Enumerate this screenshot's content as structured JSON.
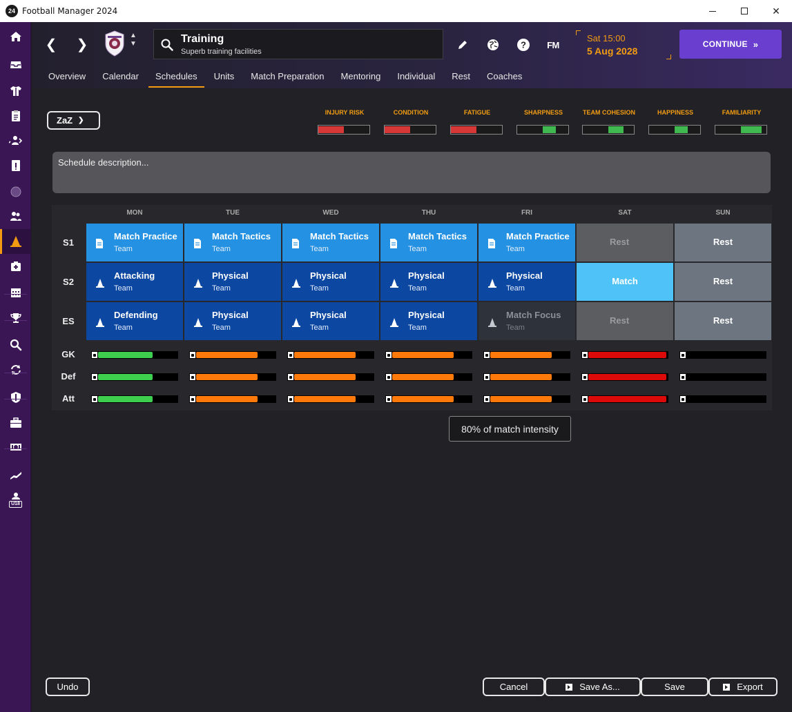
{
  "window": {
    "title": "Football Manager 2024",
    "badge": "24"
  },
  "header": {
    "search_title": "Training",
    "search_subtitle": "Superb training facilities",
    "date_line1": "Sat 15:00",
    "date_line2": "5 Aug 2028",
    "fm_label": "FM",
    "continue_label": "CONTINUE",
    "continue_chevron": "»"
  },
  "tabs": [
    "Overview",
    "Calendar",
    "Schedules",
    "Units",
    "Match Preparation",
    "Mentoring",
    "Individual",
    "Rest",
    "Coaches"
  ],
  "active_tab": "Schedules",
  "sidebar": {
    "active_index": 8,
    "icons": [
      "home-icon",
      "inbox-icon",
      "kit-icon",
      "clipboard-icon",
      "transfer-icon",
      "info-board-icon",
      "ball-icon",
      "people-icon",
      "cone-icon",
      "medical-icon",
      "calendar-icon",
      "trophy-icon",
      "scout-search-icon",
      "refresh-icon",
      "shield-icon",
      "briefcase-icon",
      "finance-icon",
      "chart-icon",
      "youth-icon"
    ],
    "youth_label": "U18"
  },
  "schedule": {
    "selector_value": "ZaZ",
    "description_placeholder": "Schedule description...",
    "stats": [
      {
        "label": "INJURY RISK",
        "level": 0.5,
        "color": "#d63838"
      },
      {
        "label": "CONDITION",
        "level": 0.5,
        "color": "#d63838"
      },
      {
        "label": "FATIGUE",
        "level": 0.5,
        "color": "#d63838"
      },
      {
        "label": "SHARPNESS",
        "level": 0.25,
        "start": 0.5,
        "color": "#3fb950"
      },
      {
        "label": "TEAM COHESION",
        "level": 0.3,
        "start": 0.5,
        "color": "#3fb950"
      },
      {
        "label": "HAPPINESS",
        "level": 0.25,
        "start": 0.5,
        "color": "#3fb950"
      },
      {
        "label": "FAMILIARITY",
        "level": 0.4,
        "start": 0.5,
        "color": "#3fb950"
      }
    ],
    "days": [
      "MON",
      "TUE",
      "WED",
      "THU",
      "FRI",
      "SAT",
      "SUN"
    ],
    "sessions": [
      "S1",
      "S2",
      "ES"
    ],
    "grid": [
      [
        {
          "name": "Match Practice",
          "sub": "Team",
          "kind": "doc",
          "color": "#2491e3"
        },
        {
          "name": "Match Tactics",
          "sub": "Team",
          "kind": "doc",
          "color": "#2491e3"
        },
        {
          "name": "Match Tactics",
          "sub": "Team",
          "kind": "doc",
          "color": "#2491e3"
        },
        {
          "name": "Match Tactics",
          "sub": "Team",
          "kind": "doc",
          "color": "#2491e3"
        },
        {
          "name": "Match Practice",
          "sub": "Team",
          "kind": "doc",
          "color": "#2491e3"
        },
        {
          "name": "Rest",
          "sub": "",
          "kind": "rest-dim",
          "color": "#5b5d61"
        },
        {
          "name": "Rest",
          "sub": "",
          "kind": "rest",
          "color": "#6d7580"
        }
      ],
      [
        {
          "name": "Attacking",
          "sub": "Team",
          "kind": "cone",
          "color": "#0c47a1"
        },
        {
          "name": "Physical",
          "sub": "Team",
          "kind": "cone",
          "color": "#0c47a1"
        },
        {
          "name": "Physical",
          "sub": "Team",
          "kind": "cone",
          "color": "#0c47a1"
        },
        {
          "name": "Physical",
          "sub": "Team",
          "kind": "cone",
          "color": "#0c47a1"
        },
        {
          "name": "Physical",
          "sub": "Team",
          "kind": "cone",
          "color": "#0c47a1"
        },
        {
          "name": "Match",
          "sub": "",
          "kind": "match",
          "color": "#4fc3f7"
        },
        {
          "name": "Rest",
          "sub": "",
          "kind": "rest",
          "color": "#6d7580"
        }
      ],
      [
        {
          "name": "Defending",
          "sub": "Team",
          "kind": "cone",
          "color": "#0c47a1"
        },
        {
          "name": "Physical",
          "sub": "Team",
          "kind": "cone",
          "color": "#0c47a1"
        },
        {
          "name": "Physical",
          "sub": "Team",
          "kind": "cone",
          "color": "#0c47a1"
        },
        {
          "name": "Physical",
          "sub": "Team",
          "kind": "cone",
          "color": "#0c47a1"
        },
        {
          "name": "Match Focus",
          "sub": "Team",
          "kind": "cone-dim",
          "color": "#2e333b"
        },
        {
          "name": "Rest",
          "sub": "",
          "kind": "rest-dim",
          "color": "#5b5d61"
        },
        {
          "name": "Rest",
          "sub": "",
          "kind": "rest",
          "color": "#6d7580"
        }
      ]
    ],
    "intensity_rows": [
      "GK",
      "Def",
      "Att"
    ],
    "intensity": [
      {
        "level": 0.68,
        "color": "#3fcf4f"
      },
      {
        "level": 0.77,
        "color": "#ff7a0a"
      },
      {
        "level": 0.77,
        "color": "#ff7a0a"
      },
      {
        "level": 0.77,
        "color": "#ff7a0a"
      },
      {
        "level": 0.77,
        "color": "#ff7a0a"
      },
      {
        "level": 0.97,
        "color": "#dd0a0a"
      },
      {
        "level": 0,
        "color": "#000000"
      }
    ],
    "tooltip": "80% of match intensity"
  },
  "footer": {
    "undo": "Undo",
    "cancel": "Cancel",
    "save_as": "Save As...",
    "save": "Save",
    "export": "Export"
  }
}
